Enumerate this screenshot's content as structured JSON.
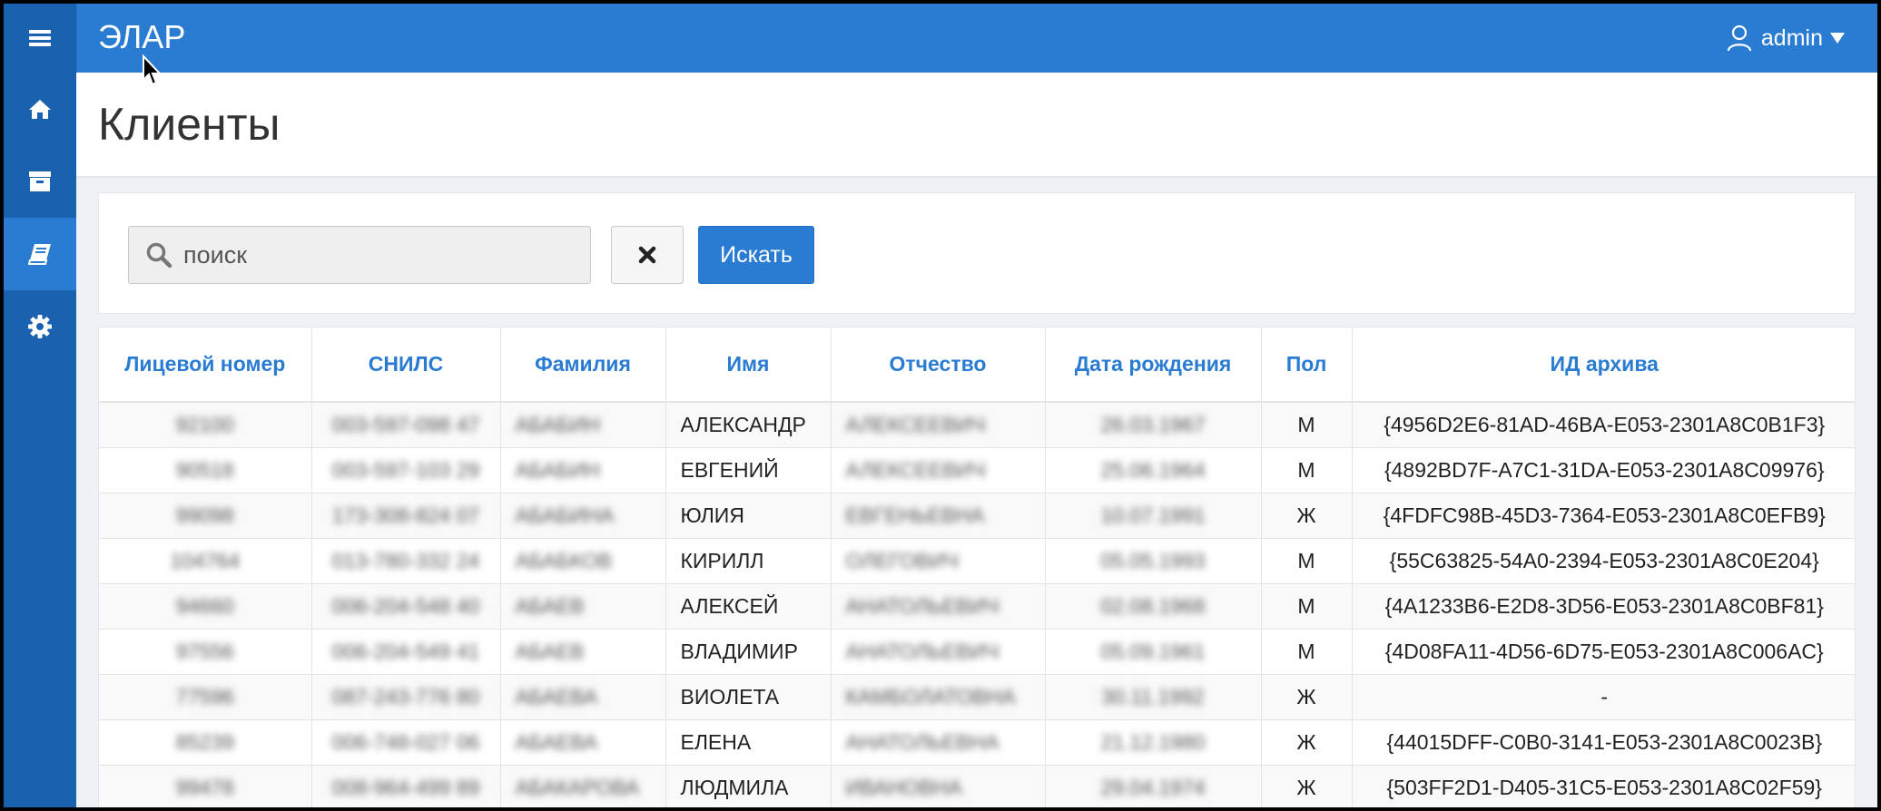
{
  "app": {
    "brand": "ЭЛАР",
    "user": "admin"
  },
  "page": {
    "title": "Клиенты"
  },
  "search": {
    "placeholder": "поиск",
    "value": "",
    "submit_label": "Искать"
  },
  "sidebar": {
    "items": [
      {
        "icon": "home-icon"
      },
      {
        "icon": "archive-icon"
      },
      {
        "icon": "book-icon",
        "active": true
      },
      {
        "icon": "gear-icon"
      }
    ]
  },
  "table": {
    "columns": [
      "Лицевой номер",
      "СНИЛС",
      "Фамилия",
      "Имя",
      "Отчество",
      "Дата рождения",
      "Пол",
      "ИД архива"
    ],
    "rows": [
      [
        "92100",
        "003-597-098 47",
        "АБАБИН",
        "АЛЕКСАНДР",
        "АЛЕКСЕЕВИЧ",
        "26.03.1967",
        "М",
        "{4956D2E6-81AD-46BA-E053-2301A8C0B1F3}"
      ],
      [
        "90518",
        "003-597-103 29",
        "АБАБИН",
        "ЕВГЕНИЙ",
        "АЛЕКСЕЕВИЧ",
        "25.06.1964",
        "М",
        "{4892BD7F-A7C1-31DA-E053-2301A8C09976}"
      ],
      [
        "99098",
        "173-308-824 07",
        "АБАБИНА",
        "ЮЛИЯ",
        "ЕВГЕНЬЕВНА",
        "10.07.1991",
        "Ж",
        "{4FDFC98B-45D3-7364-E053-2301A8C0EFB9}"
      ],
      [
        "104764",
        "013-780-332 24",
        "АБАБКОВ",
        "КИРИЛЛ",
        "ОЛЕГОВИЧ",
        "05.05.1993",
        "М",
        "{55C63825-54A0-2394-E053-2301A8C0E204}"
      ],
      [
        "94660",
        "006-204-548 40",
        "АБАЕВ",
        "АЛЕКСЕЙ",
        "АНАТОЛЬЕВИЧ",
        "02.08.1968",
        "М",
        "{4A1233B6-E2D8-3D56-E053-2301A8C0BF81}"
      ],
      [
        "97556",
        "006-204-549 41",
        "АБАЕВ",
        "ВЛАДИМИР",
        "АНАТОЛЬЕВИЧ",
        "05.09.1961",
        "М",
        "{4D08FA11-4D56-6D75-E053-2301A8C006AC}"
      ],
      [
        "77596",
        "087-243-776 80",
        "АБАЕВА",
        "ВИОЛЕТА",
        "КАМБОЛАТОВНА",
        "30.11.1992",
        "Ж",
        "-"
      ],
      [
        "85239",
        "006-748-027 06",
        "АБАЕВА",
        "ЕЛЕНА",
        "АНАТОЛЬЕВНА",
        "21.12.1980",
        "Ж",
        "{44015DFF-C0B0-3141-E053-2301A8C0023B}"
      ],
      [
        "99478",
        "008-964-499 89",
        "АБАКАРОВА",
        "ЛЮДМИЛА",
        "ИВАНОВНА",
        "29.04.1974",
        "Ж",
        "{503FF2D1-D405-31C5-E053-2301A8C02F59}"
      ]
    ]
  }
}
